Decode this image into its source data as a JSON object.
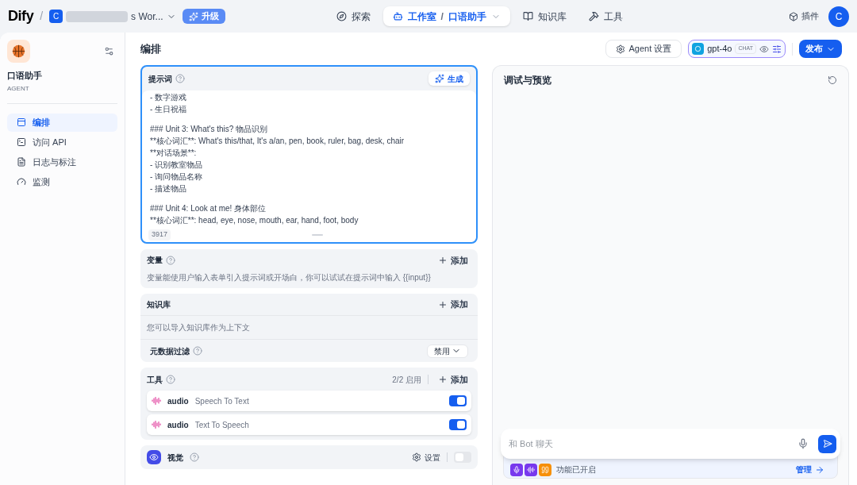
{
  "topbar": {
    "logo": "Dify",
    "separator": "/",
    "workspace_initial": "C",
    "workspace_name": "s Wor...",
    "upgrade": "升级",
    "nav": [
      {
        "kind": "explore",
        "label": "探索",
        "selected": false
      },
      {
        "kind": "studio",
        "label": "工作室",
        "separator": "/",
        "app": "口语助手",
        "selected": true
      },
      {
        "kind": "knowledge",
        "label": "知识库",
        "selected": false
      },
      {
        "kind": "tools",
        "label": "工具",
        "selected": false
      }
    ],
    "plugins": "插件",
    "avatar": "C"
  },
  "sidebar": {
    "app_name": "口语助手",
    "app_type": "AGENT",
    "items": [
      {
        "kind": "layout",
        "label": "编排",
        "selected": true
      },
      {
        "kind": "api",
        "label": "访问 API",
        "selected": false
      },
      {
        "kind": "logs",
        "label": "日志与标注",
        "selected": false
      },
      {
        "kind": "monitor",
        "label": "监测",
        "selected": false
      }
    ]
  },
  "header": {
    "title": "编排",
    "agent_settings": "Agent 设置",
    "model": "gpt-4o",
    "model_badge": "CHAT",
    "publish": "发布"
  },
  "prompt": {
    "title": "提示词",
    "generate": "生成",
    "count": "3917",
    "blocks": [
      [
        "- 数字游戏",
        "- 生日祝福"
      ],
      [
        "### Unit 3: What's this? 物品识别",
        "**核心词汇**: What's this/that, It's a/an, pen, book, ruler, bag, desk, chair",
        "**对话场景**:",
        "- 识别教室物品",
        "- 询问物品名称",
        "- 描述物品"
      ],
      [
        "### Unit 4: Look at me! 身体部位",
        "**核心词汇**: head, eye, nose, mouth, ear, hand, foot, body"
      ]
    ]
  },
  "variables": {
    "title": "变量",
    "add": "添加",
    "description": "变量能使用户输入表单引入提示词或开场白，你可以试试在提示词中输入 {{input}}"
  },
  "knowledge": {
    "title": "知识库",
    "add": "添加",
    "description": "您可以导入知识库作为上下文",
    "filter_label": "元数据过滤",
    "filter_value": "禁用"
  },
  "tools": {
    "title": "工具",
    "enabled_count": "2/2 启用",
    "add": "添加",
    "items": [
      {
        "provider": "audio",
        "name": "Speech To Text",
        "on": true
      },
      {
        "provider": "audio",
        "name": "Text To Speech",
        "on": true
      }
    ]
  },
  "vision": {
    "title": "视觉",
    "settings": "设置",
    "on": false
  },
  "preview": {
    "title": "调试与预览",
    "placeholder": "和 Bot 聊天",
    "features": "功能已开启",
    "manage": "管理"
  }
}
